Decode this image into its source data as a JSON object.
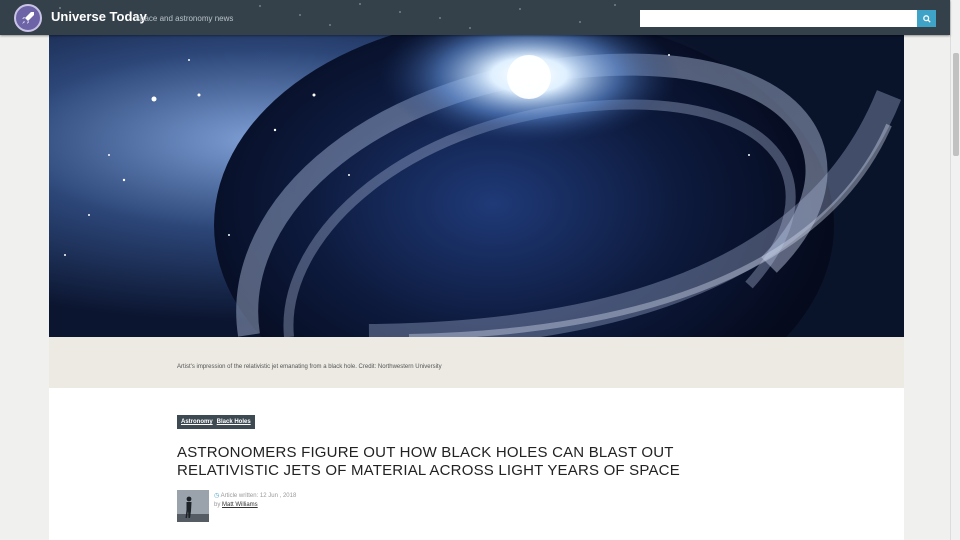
{
  "header": {
    "site_title": "Universe Today",
    "tagline": "space and astronomy news",
    "logo_icon": "rocket-icon",
    "search_placeholder": "",
    "search_icon": "search-icon"
  },
  "hero": {
    "caption": "Artist's impression of the relativistic jet emanating from a black hole. Credit: Northwestern University"
  },
  "article": {
    "tags": [
      "Astronomy",
      "Black Holes"
    ],
    "title": "ASTRONOMERS FIGURE OUT HOW BLACK HOLES CAN BLAST OUT RELATIVISTIC JETS OF MATERIAL ACROSS LIGHT YEARS OF SPACE",
    "date_label": "Article written: 12 Jun , 2018",
    "by_label": "by",
    "author": "Matt Williams"
  },
  "colors": {
    "topbar": "#34414a",
    "accent": "#3fa3c7",
    "caption_band": "#eceae2",
    "tag_background": "#3d4a52"
  }
}
